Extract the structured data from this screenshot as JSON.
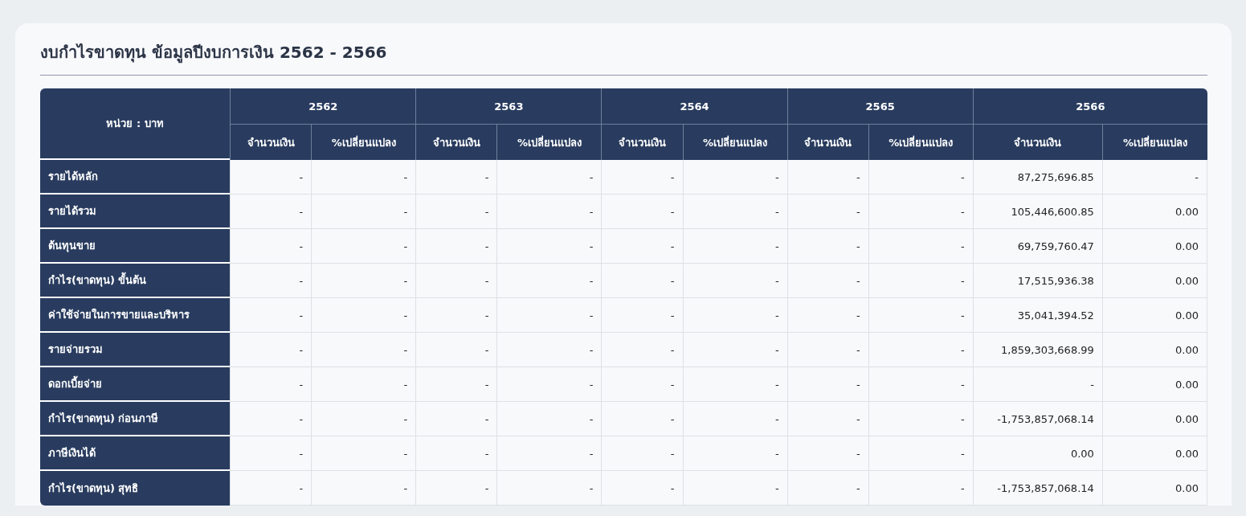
{
  "title": "งบกำไรขาดทุน ข้อมูลปีงบการเงิน 2562 - 2566",
  "table": {
    "unit_label": "หน่วย : บาท",
    "years": [
      {
        "year": "2562",
        "columns": [
          "จำนวนเงิน",
          "%เปลี่ยนแปลง"
        ]
      },
      {
        "year": "2563",
        "columns": [
          "จำนวนเงิน",
          "%เปลี่ยนแปลง"
        ]
      },
      {
        "year": "2564",
        "columns": [
          "จำนวนเงิน",
          "%เปลี่ยนแปลง"
        ]
      },
      {
        "year": "2565",
        "columns": [
          "จำนวนเงิน",
          "%เปลี่ยนแปลง"
        ]
      },
      {
        "year": "2566",
        "columns": [
          "จำนวนเงิน",
          "%เปลี่ยนแปลง"
        ]
      }
    ],
    "rows": [
      {
        "label": "รายได้หลัก",
        "cells": [
          "-",
          "-",
          "-",
          "-",
          "-",
          "-",
          "-",
          "-",
          "87,275,696.85",
          "-"
        ]
      },
      {
        "label": "รายได้รวม",
        "cells": [
          "-",
          "-",
          "-",
          "-",
          "-",
          "-",
          "-",
          "-",
          "105,446,600.85",
          "0.00"
        ]
      },
      {
        "label": "ต้นทุนขาย",
        "cells": [
          "-",
          "-",
          "-",
          "-",
          "-",
          "-",
          "-",
          "-",
          "69,759,760.47",
          "0.00"
        ]
      },
      {
        "label": "กำไร(ขาดทุน) ขั้นต้น",
        "cells": [
          "-",
          "-",
          "-",
          "-",
          "-",
          "-",
          "-",
          "-",
          "17,515,936.38",
          "0.00"
        ]
      },
      {
        "label": "ค่าใช้จ่ายในการขายและบริหาร",
        "cells": [
          "-",
          "-",
          "-",
          "-",
          "-",
          "-",
          "-",
          "-",
          "35,041,394.52",
          "0.00"
        ]
      },
      {
        "label": "รายจ่ายรวม",
        "cells": [
          "-",
          "-",
          "-",
          "-",
          "-",
          "-",
          "-",
          "-",
          "1,859,303,668.99",
          "0.00"
        ]
      },
      {
        "label": "ดอกเบี้ยจ่าย",
        "cells": [
          "-",
          "-",
          "-",
          "-",
          "-",
          "-",
          "-",
          "-",
          "-",
          "0.00"
        ]
      },
      {
        "label": "กำไร(ขาดทุน) ก่อนภาษี",
        "cells": [
          "-",
          "-",
          "-",
          "-",
          "-",
          "-",
          "-",
          "-",
          "-1,753,857,068.14",
          "0.00"
        ]
      },
      {
        "label": "ภาษีเงินได้",
        "cells": [
          "-",
          "-",
          "-",
          "-",
          "-",
          "-",
          "-",
          "-",
          "0.00",
          "0.00"
        ]
      },
      {
        "label": "กำไร(ขาดทุน) สุทธิ",
        "cells": [
          "-",
          "-",
          "-",
          "-",
          "-",
          "-",
          "-",
          "-",
          "-1,753,857,068.14",
          "0.00"
        ]
      }
    ]
  }
}
